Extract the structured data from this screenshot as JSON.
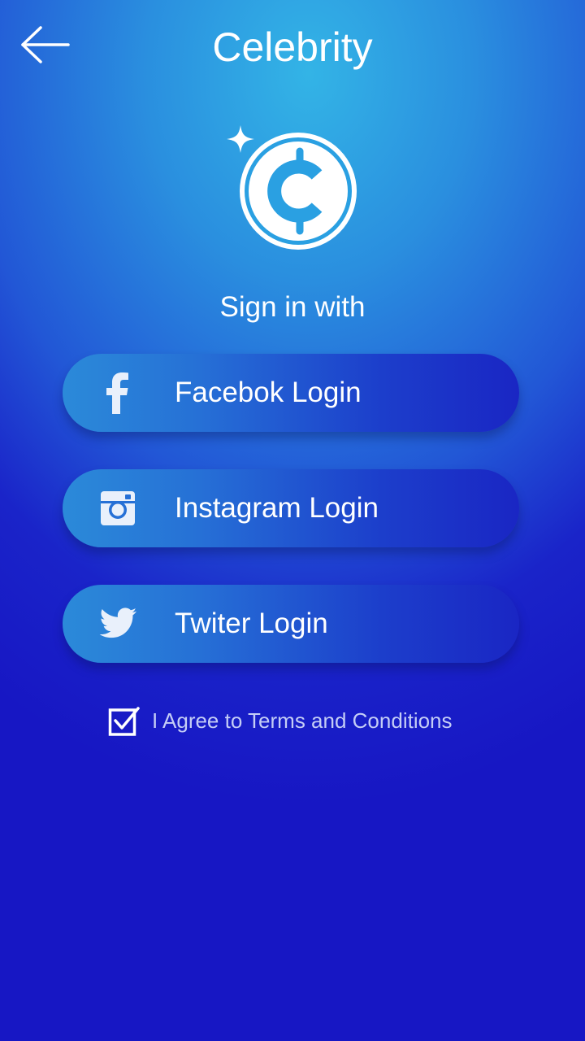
{
  "header": {
    "title": "Celebrity",
    "back_icon": "arrow-left-icon"
  },
  "logo": {
    "icon": "cent-coin-icon",
    "accent_icon": "sparkle-icon"
  },
  "signin": {
    "label": "Sign in with"
  },
  "login_buttons": [
    {
      "label": "Facebok Login",
      "icon": "facebook-icon"
    },
    {
      "label": "Instagram Login",
      "icon": "instagram-icon"
    },
    {
      "label": "Twiter Login",
      "icon": "twitter-icon"
    }
  ],
  "terms": {
    "checked": true,
    "label": "I Agree to Terms and Conditions",
    "icon": "checkbox-checked-icon"
  },
  "colors": {
    "background_top": "#33b4e6",
    "background_bottom": "#1717c4",
    "button_left": "#2b8ad9",
    "button_right": "#1a26c4",
    "text": "#ffffff",
    "terms_text": "#c4cdf6"
  }
}
